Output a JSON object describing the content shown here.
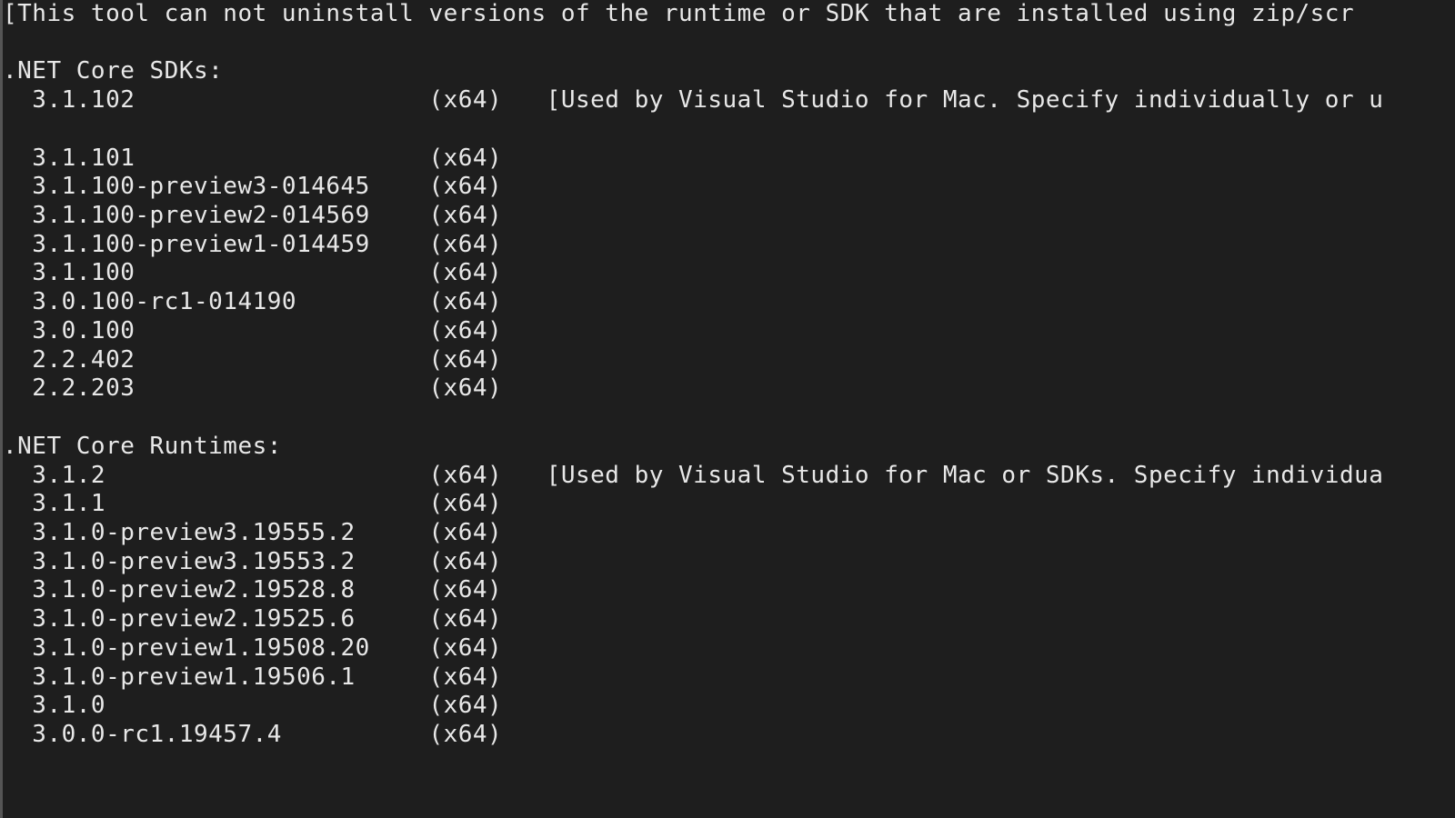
{
  "header_note": "[This tool can not uninstall versions of the runtime or SDK that are installed using zip/scr",
  "sdks": {
    "title": ".NET Core SDKs:",
    "items": [
      {
        "version": "3.1.102",
        "arch": "(x64)",
        "note": "[Used by Visual Studio for Mac. Specify individually or u",
        "blank_after": true
      },
      {
        "version": "3.1.101",
        "arch": "(x64)",
        "note": ""
      },
      {
        "version": "3.1.100-preview3-014645",
        "arch": "(x64)",
        "note": ""
      },
      {
        "version": "3.1.100-preview2-014569",
        "arch": "(x64)",
        "note": ""
      },
      {
        "version": "3.1.100-preview1-014459",
        "arch": "(x64)",
        "note": ""
      },
      {
        "version": "3.1.100",
        "arch": "(x64)",
        "note": ""
      },
      {
        "version": "3.0.100-rc1-014190",
        "arch": "(x64)",
        "note": ""
      },
      {
        "version": "3.0.100",
        "arch": "(x64)",
        "note": ""
      },
      {
        "version": "2.2.402",
        "arch": "(x64)",
        "note": ""
      },
      {
        "version": "2.2.203",
        "arch": "(x64)",
        "note": ""
      }
    ]
  },
  "runtimes": {
    "title": ".NET Core Runtimes:",
    "items": [
      {
        "version": "3.1.2",
        "arch": "(x64)",
        "note": "[Used by Visual Studio for Mac or SDKs. Specify individua"
      },
      {
        "version": "3.1.1",
        "arch": "(x64)",
        "note": ""
      },
      {
        "version": "3.1.0-preview3.19555.2",
        "arch": "(x64)",
        "note": ""
      },
      {
        "version": "3.1.0-preview3.19553.2",
        "arch": "(x64)",
        "note": ""
      },
      {
        "version": "3.1.0-preview2.19528.8",
        "arch": "(x64)",
        "note": ""
      },
      {
        "version": "3.1.0-preview2.19525.6",
        "arch": "(x64)",
        "note": ""
      },
      {
        "version": "3.1.0-preview1.19508.20",
        "arch": "(x64)",
        "note": ""
      },
      {
        "version": "3.1.0-preview1.19506.1",
        "arch": "(x64)",
        "note": ""
      },
      {
        "version": "3.1.0",
        "arch": "(x64)",
        "note": ""
      },
      {
        "version": "3.0.0-rc1.19457.4",
        "arch": "(x64)",
        "note": ""
      }
    ]
  },
  "layout": {
    "version_col_width": 27,
    "arch_col_width": 7,
    "indent": "  "
  }
}
